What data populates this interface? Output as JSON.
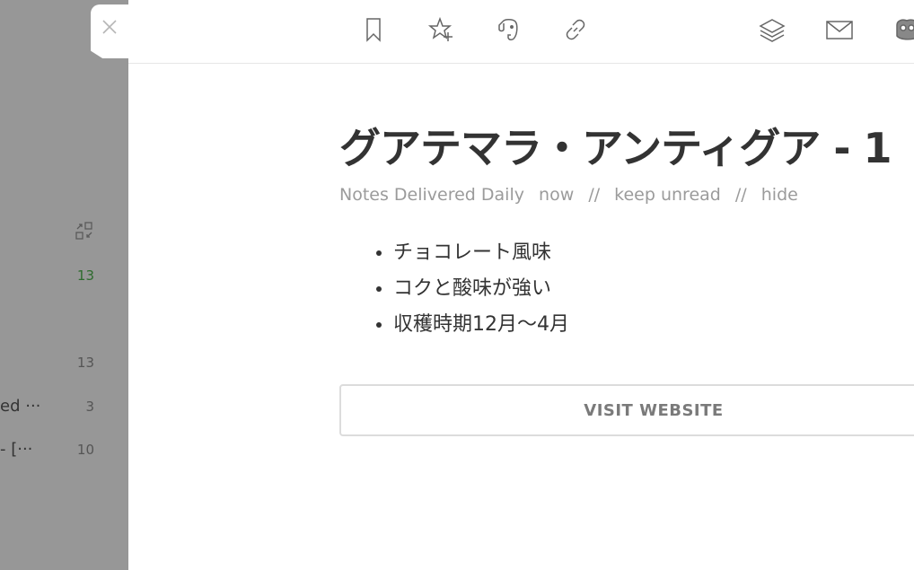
{
  "background": {
    "rows": [
      {
        "label": "",
        "count": "13",
        "highlight": true
      },
      {
        "label": "",
        "count": "13",
        "highlight": false
      },
      {
        "label": "ed ···",
        "count": "3",
        "highlight": false
      },
      {
        "label": "- [···",
        "count": "10",
        "highlight": false
      }
    ],
    "collapse_icon": "collapse-icon"
  },
  "close": {
    "icon": "close-icon"
  },
  "toolbar": {
    "buttons": [
      {
        "name": "bookmark",
        "icon": "bookmark-icon"
      },
      {
        "name": "favorite",
        "icon": "star-plus-icon"
      },
      {
        "name": "evernote",
        "icon": "evernote-icon"
      },
      {
        "name": "link",
        "icon": "link-icon"
      },
      {
        "name": "layers",
        "icon": "layers-icon"
      },
      {
        "name": "email",
        "icon": "mail-icon"
      },
      {
        "name": "share",
        "icon": "hootsuite-icon"
      }
    ]
  },
  "article": {
    "title": "グアテマラ・アンティグア - 1",
    "source": "Notes Delivered Daily",
    "time": "now",
    "separator": "//",
    "keep_unread": "keep unread",
    "hide": "hide",
    "bullets": [
      "チョコレート風味",
      "コクと酸味が強い",
      "収穫時期12月〜4月"
    ],
    "visit_label": "VISIT WEBSITE"
  },
  "colors": {
    "backdrop": "#979797",
    "panel": "#ffffff",
    "title": "#333333",
    "meta": "#9b9b9b",
    "count_green": "#2f6b2f"
  }
}
